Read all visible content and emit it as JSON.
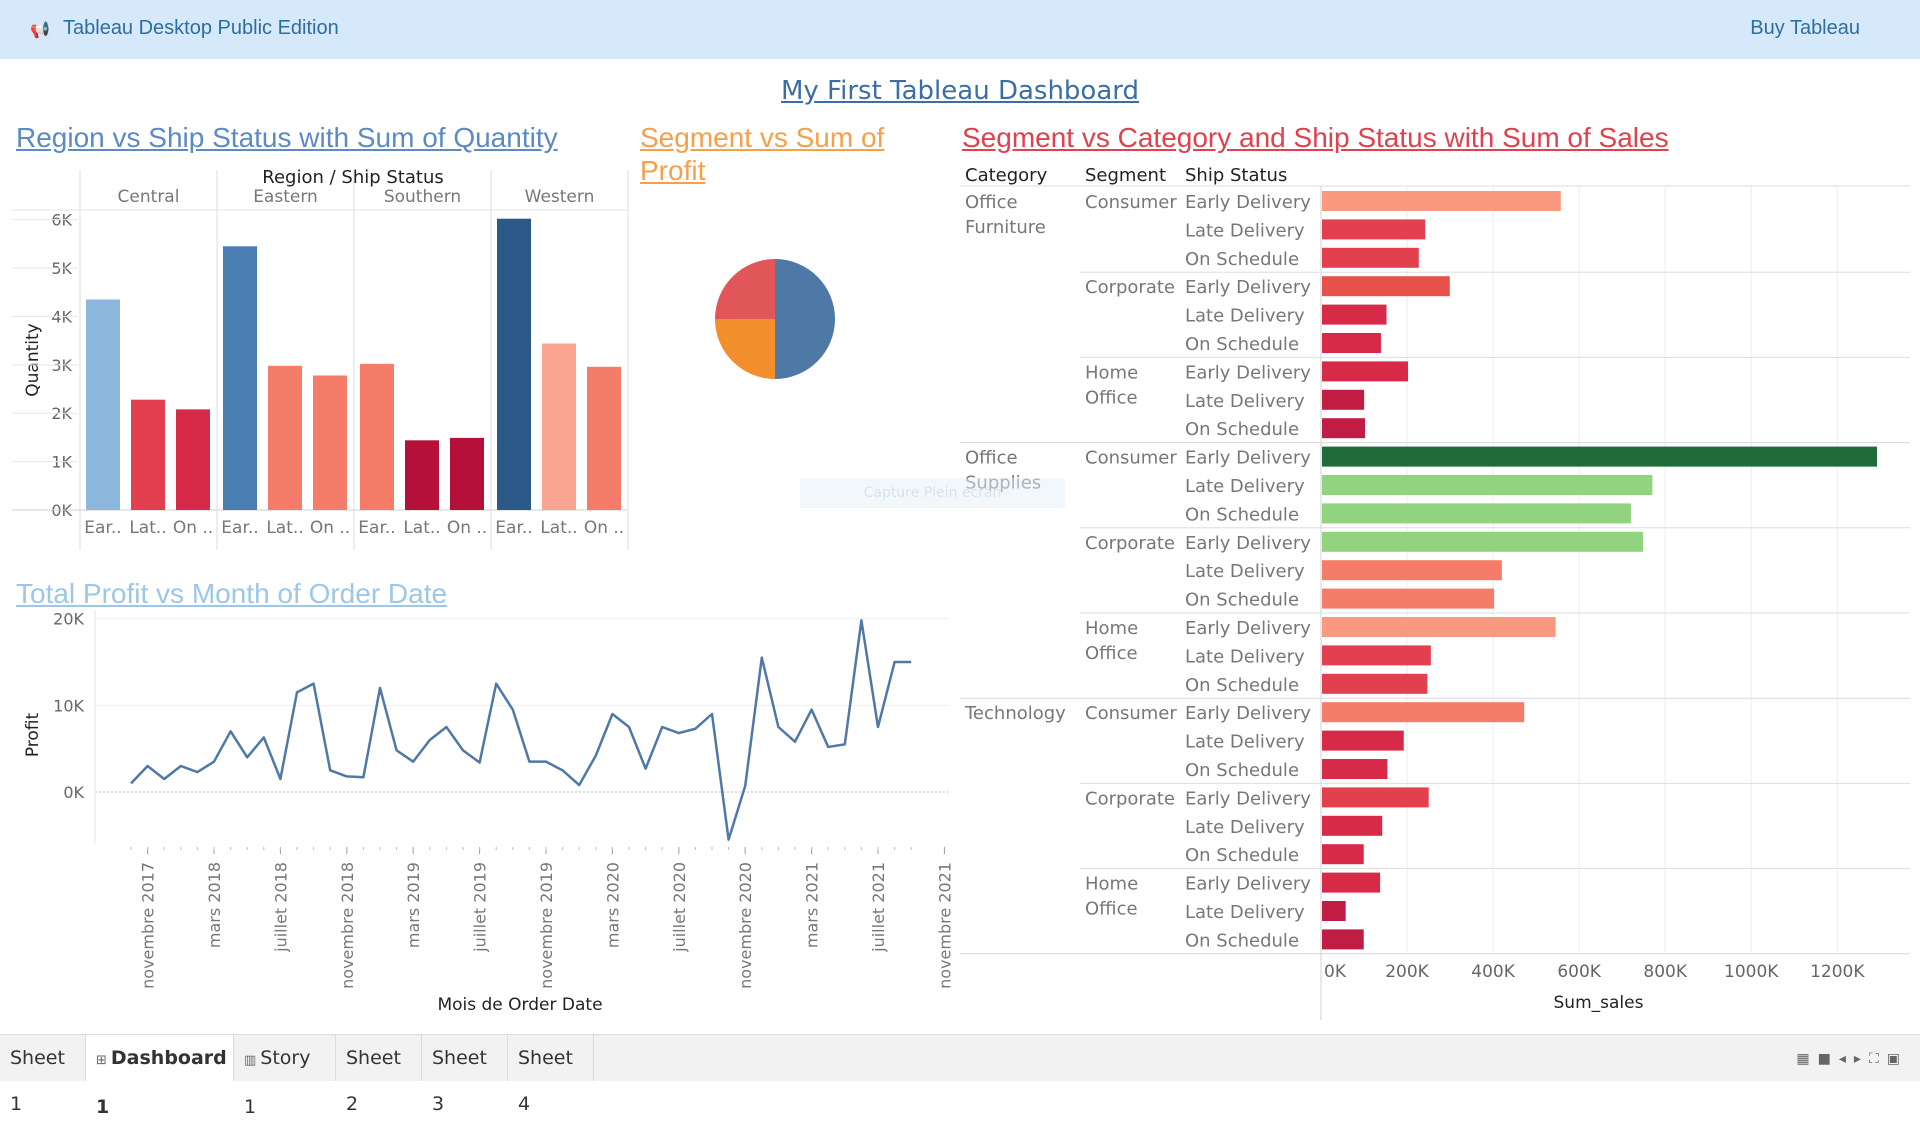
{
  "app": {
    "title": "Tableau Desktop Public Edition",
    "buy_label": "Buy Tableau",
    "icon": "megaphone-icon"
  },
  "dashboard": {
    "title": "My First Tableau Dashboard"
  },
  "sheets": {
    "region": {
      "title": "Region vs Ship Status with Sum of Quantity"
    },
    "segment": {
      "title": "Segment vs Sum of Profit"
    },
    "segcat": {
      "title": "Segment vs Category and Ship Status with Sum of Sales"
    },
    "profit": {
      "title": "Total Profit vs Month of Order Date"
    }
  },
  "watermark": "Capture Plein écran",
  "chart_data": [
    {
      "type": "bar",
      "title": "Region vs Ship Status with Sum of Quantity",
      "header": "Region / Ship Status",
      "ylabel": "Quantity",
      "ylim": [
        0,
        6200
      ],
      "yticks": [
        0,
        1000,
        2000,
        3000,
        4000,
        5000,
        6000
      ],
      "ytick_labels": [
        "0K",
        "1K",
        "2K",
        "3K",
        "4K",
        "5K",
        "6K"
      ],
      "regions": [
        "Central",
        "Eastern",
        "Southern",
        "Western"
      ],
      "ship_status_labels": [
        "Ear..",
        "Lat..",
        "On .."
      ],
      "values": [
        [
          4350,
          2280,
          2080
        ],
        [
          5450,
          2980,
          2780
        ],
        [
          3020,
          1440,
          1490
        ],
        [
          6020,
          3440,
          2960
        ]
      ],
      "colors": [
        [
          "#8cb8dd",
          "#e2404f",
          "#d62a48"
        ],
        [
          "#4a7db1",
          "#f47c69",
          "#f47c69"
        ],
        [
          "#f47c69",
          "#b5103a",
          "#b5103a"
        ],
        [
          "#2b5a88",
          "#f9a58f",
          "#f47c69"
        ]
      ]
    },
    {
      "type": "pie",
      "title": "Segment vs Sum of Profit",
      "values": [
        50,
        25,
        25
      ],
      "colors": [
        "#4e79a7",
        "#f28e2b",
        "#e15759"
      ]
    },
    {
      "type": "bar",
      "title": "Segment vs Category and Ship Status with Sum of Sales",
      "headers": [
        "Category",
        "Segment",
        "Ship Status"
      ],
      "xlabel": "Sum_sales",
      "xlim": [
        0,
        1290000
      ],
      "xticks": [
        0,
        200000,
        400000,
        600000,
        800000,
        1000000,
        1200000
      ],
      "xtick_labels": [
        "0K",
        "200K",
        "400K",
        "600K",
        "800K",
        "1000K",
        "1200K"
      ],
      "ship_statuses": [
        "Early Delivery",
        "Late Delivery",
        "On Schedule"
      ],
      "categories": [
        {
          "name": "Office Furniture",
          "segments": [
            {
              "name": "Consumer",
              "values": [
                555000,
                240000,
                225000
              ],
              "colors": [
                "#f9997f",
                "#e2404f",
                "#e2404f"
              ]
            },
            {
              "name": "Corporate",
              "values": [
                297000,
                150000,
                137000
              ],
              "colors": [
                "#e8504a",
                "#d62a48",
                "#d62a48"
              ]
            },
            {
              "name": "Home Office",
              "values": [
                200000,
                98000,
                100000
              ],
              "colors": [
                "#d62a48",
                "#c01c44",
                "#c01c44"
              ]
            }
          ]
        },
        {
          "name": "Office Supplies",
          "segments": [
            {
              "name": "Consumer",
              "values": [
                1290000,
                768000,
                718000
              ],
              "colors": [
                "#1f6b3a",
                "#91d37e",
                "#91d37e"
              ]
            },
            {
              "name": "Corporate",
              "values": [
                746000,
                418000,
                400000
              ],
              "colors": [
                "#91d37e",
                "#f47c69",
                "#f47c69"
              ]
            },
            {
              "name": "Home Office",
              "values": [
                543000,
                253000,
                245000
              ],
              "colors": [
                "#f9997f",
                "#e2404f",
                "#e2404f"
              ]
            }
          ]
        },
        {
          "name": "Technology",
          "segments": [
            {
              "name": "Consumer",
              "values": [
                470000,
                190000,
                152000
              ],
              "colors": [
                "#f47c69",
                "#d62a48",
                "#d62a48"
              ]
            },
            {
              "name": "Corporate",
              "values": [
                248000,
                140000,
                97000
              ],
              "colors": [
                "#e2404f",
                "#d62a48",
                "#d62a48"
              ]
            },
            {
              "name": "Home Office",
              "values": [
                135000,
                55000,
                97000
              ],
              "colors": [
                "#d62a48",
                "#c01c44",
                "#c01c44"
              ]
            }
          ]
        }
      ]
    },
    {
      "type": "line",
      "title": "Total Profit vs Month of Order Date",
      "ylabel": "Profit",
      "xlabel": "Mois de Order Date",
      "ylim": [
        -6000,
        21000
      ],
      "yticks": [
        0,
        10000,
        20000
      ],
      "ytick_labels": [
        "0K",
        "10K",
        "20K"
      ],
      "x_start": "octobre 2017",
      "x_labels": [
        "novembre 2017",
        "mars 2018",
        "juillet 2018",
        "novembre 2018",
        "mars 2019",
        "juillet 2019",
        "novembre 2019",
        "mars 2020",
        "juillet 2020",
        "novembre 2020",
        "mars 2021",
        "juillet 2021",
        "novembre 2021"
      ],
      "series": [
        {
          "color": "#4e79a7",
          "values": [
            1000,
            3000,
            1500,
            3000,
            2300,
            3500,
            7000,
            4000,
            6300,
            1500,
            11500,
            12500,
            2500,
            1800,
            1700,
            12000,
            4800,
            3500,
            6000,
            7500,
            4800,
            3400,
            12500,
            9500,
            3500,
            3500,
            2500,
            800,
            4200,
            9000,
            7500,
            2700,
            7500,
            6800,
            7300,
            9000,
            -5500,
            700,
            15500,
            7500,
            5800,
            9500,
            5200,
            5500,
            19800,
            7500,
            15000,
            15000
          ]
        }
      ]
    }
  ],
  "tabs": [
    {
      "label": "Sheet 1",
      "icon": ""
    },
    {
      "label": "Dashboard 1",
      "icon": "dashboard-icon",
      "active": true
    },
    {
      "label": "Story 1",
      "icon": "story-icon"
    },
    {
      "label": "Sheet 2",
      "icon": ""
    },
    {
      "label": "Sheet 3",
      "icon": ""
    },
    {
      "label": "Sheet 4",
      "icon": ""
    }
  ]
}
